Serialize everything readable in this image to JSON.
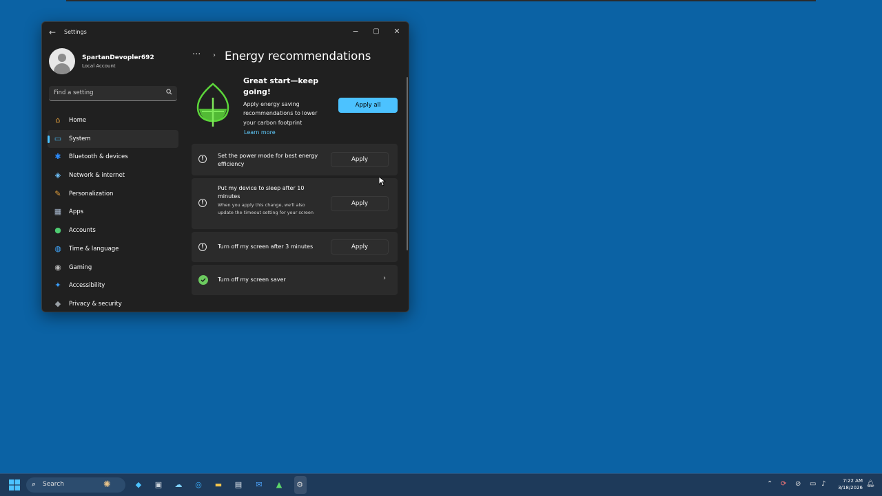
{
  "window": {
    "title": "Settings",
    "back_glyph": "←",
    "controls": {
      "minimize": "−",
      "maximize": "▢",
      "close": "✕"
    }
  },
  "profile": {
    "name": "SpartanDevopler692",
    "account": "Local Account"
  },
  "search": {
    "placeholder": "Find a setting",
    "icon": "search-icon"
  },
  "nav": [
    {
      "label": "Home",
      "icon": "home-icon",
      "glyph": "⌂",
      "color": "#e8a33c",
      "selected": false
    },
    {
      "label": "System",
      "icon": "system-icon",
      "glyph": "▭",
      "color": "#4cc2ff",
      "selected": true
    },
    {
      "label": "Bluetooth & devices",
      "icon": "bluetooth-icon",
      "glyph": "✱",
      "color": "#2b8cff",
      "selected": false
    },
    {
      "label": "Network & internet",
      "icon": "wifi-icon",
      "glyph": "◈",
      "color": "#6fc3ff",
      "selected": false
    },
    {
      "label": "Personalization",
      "icon": "brush-icon",
      "glyph": "✎",
      "color": "#e8a23c",
      "selected": false
    },
    {
      "label": "Apps",
      "icon": "apps-icon",
      "glyph": "▦",
      "color": "#a3b3c8",
      "selected": false
    },
    {
      "label": "Accounts",
      "icon": "accounts-icon",
      "glyph": "●",
      "color": "#4ecb71",
      "selected": false
    },
    {
      "label": "Time & language",
      "icon": "globe-icon",
      "glyph": "◍",
      "color": "#3fa7ff",
      "selected": false
    },
    {
      "label": "Gaming",
      "icon": "gamepad-icon",
      "glyph": "◉",
      "color": "#b7b7b7",
      "selected": false
    },
    {
      "label": "Accessibility",
      "icon": "accessibility-icon",
      "glyph": "✦",
      "color": "#3aa0ff",
      "selected": false
    },
    {
      "label": "Privacy & security",
      "icon": "shield-icon",
      "glyph": "◆",
      "color": "#9aa0a6",
      "selected": false
    }
  ],
  "breadcrumb": {
    "ellipsis": "···",
    "chevron": "›",
    "title": "Energy recommendations"
  },
  "hero": {
    "title": "Great start—keep going!",
    "description": "Apply energy saving recommendations to lower your carbon footprint",
    "learn_more": "Learn more",
    "apply_all": "Apply all"
  },
  "recommendations": [
    {
      "title": "Set the power mode for best energy efficiency",
      "subtitle": "",
      "action": "Apply",
      "status": "info"
    },
    {
      "title": "Put my device to sleep after 10 minutes",
      "subtitle": "When you apply this change, we'll also update the timeout setting for your screen",
      "action": "Apply",
      "status": "info"
    },
    {
      "title": "Turn off my screen after 3 minutes",
      "subtitle": "",
      "action": "Apply",
      "status": "info"
    },
    {
      "title": "Turn off my screen saver",
      "subtitle": "",
      "action": "",
      "status": "done"
    }
  ],
  "info_glyph": "!",
  "arrow_glyph": "›",
  "colors": {
    "accent": "#4cc2ff",
    "desktop": "#0b62a4",
    "window_bg": "#202020",
    "card_bg": "#2b2b2b",
    "leaf": "#5cd63a",
    "done": "#6ccb5f"
  },
  "taskbar": {
    "search_label": "Search",
    "search_glyph": "⌕",
    "clock_time": "7:22 AM",
    "clock_date": "3/18/2026"
  }
}
